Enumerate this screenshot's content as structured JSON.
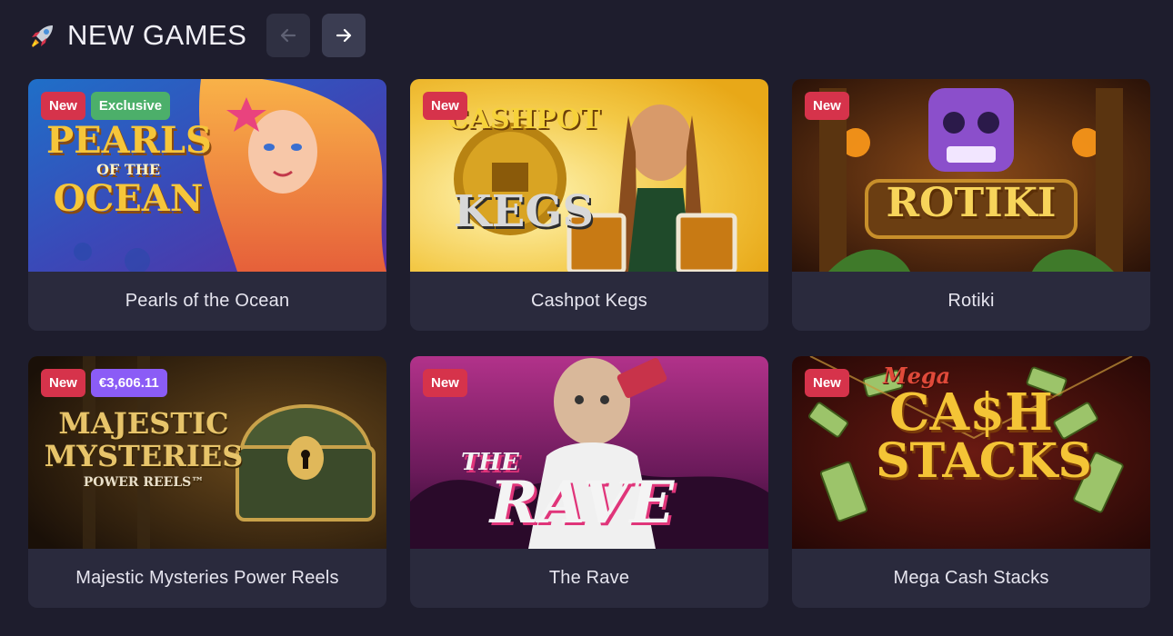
{
  "header": {
    "icon": "rocket-icon",
    "title": "NEW GAMES",
    "prev_icon": "arrow-left-icon",
    "next_icon": "arrow-right-icon"
  },
  "games": [
    {
      "title": "Pearls of the Ocean",
      "badges": {
        "new": "New",
        "exclusive": "Exclusive"
      },
      "art_text": [
        "PEARLS",
        "OF THE",
        "OCEAN"
      ]
    },
    {
      "title": "Cashpot Kegs",
      "badges": {
        "new": "New"
      },
      "art_text": [
        "CASHPOT",
        "KEGS"
      ]
    },
    {
      "title": "Rotiki",
      "badges": {
        "new": "New"
      },
      "art_text": [
        "ROTIKI"
      ]
    },
    {
      "title": "Majestic Mysteries Power Reels",
      "badges": {
        "new": "New",
        "jackpot": "€3,606.11"
      },
      "art_text": [
        "MAJESTIC",
        "MYSTERIES",
        "POWER REELS™"
      ]
    },
    {
      "title": "The Rave",
      "badges": {
        "new": "New"
      },
      "art_text": [
        "THE",
        "RAVE"
      ]
    },
    {
      "title": "Mega Cash Stacks",
      "badges": {
        "new": "New"
      },
      "art_text": [
        "Mega",
        "CA$H",
        "STACKS"
      ]
    }
  ],
  "colors": {
    "background": "#1e1d2d",
    "card": "#2a2a3d",
    "badge_new": "#d6334b",
    "badge_exclusive": "#4caf6a",
    "badge_jackpot": "#8b5cf6"
  }
}
